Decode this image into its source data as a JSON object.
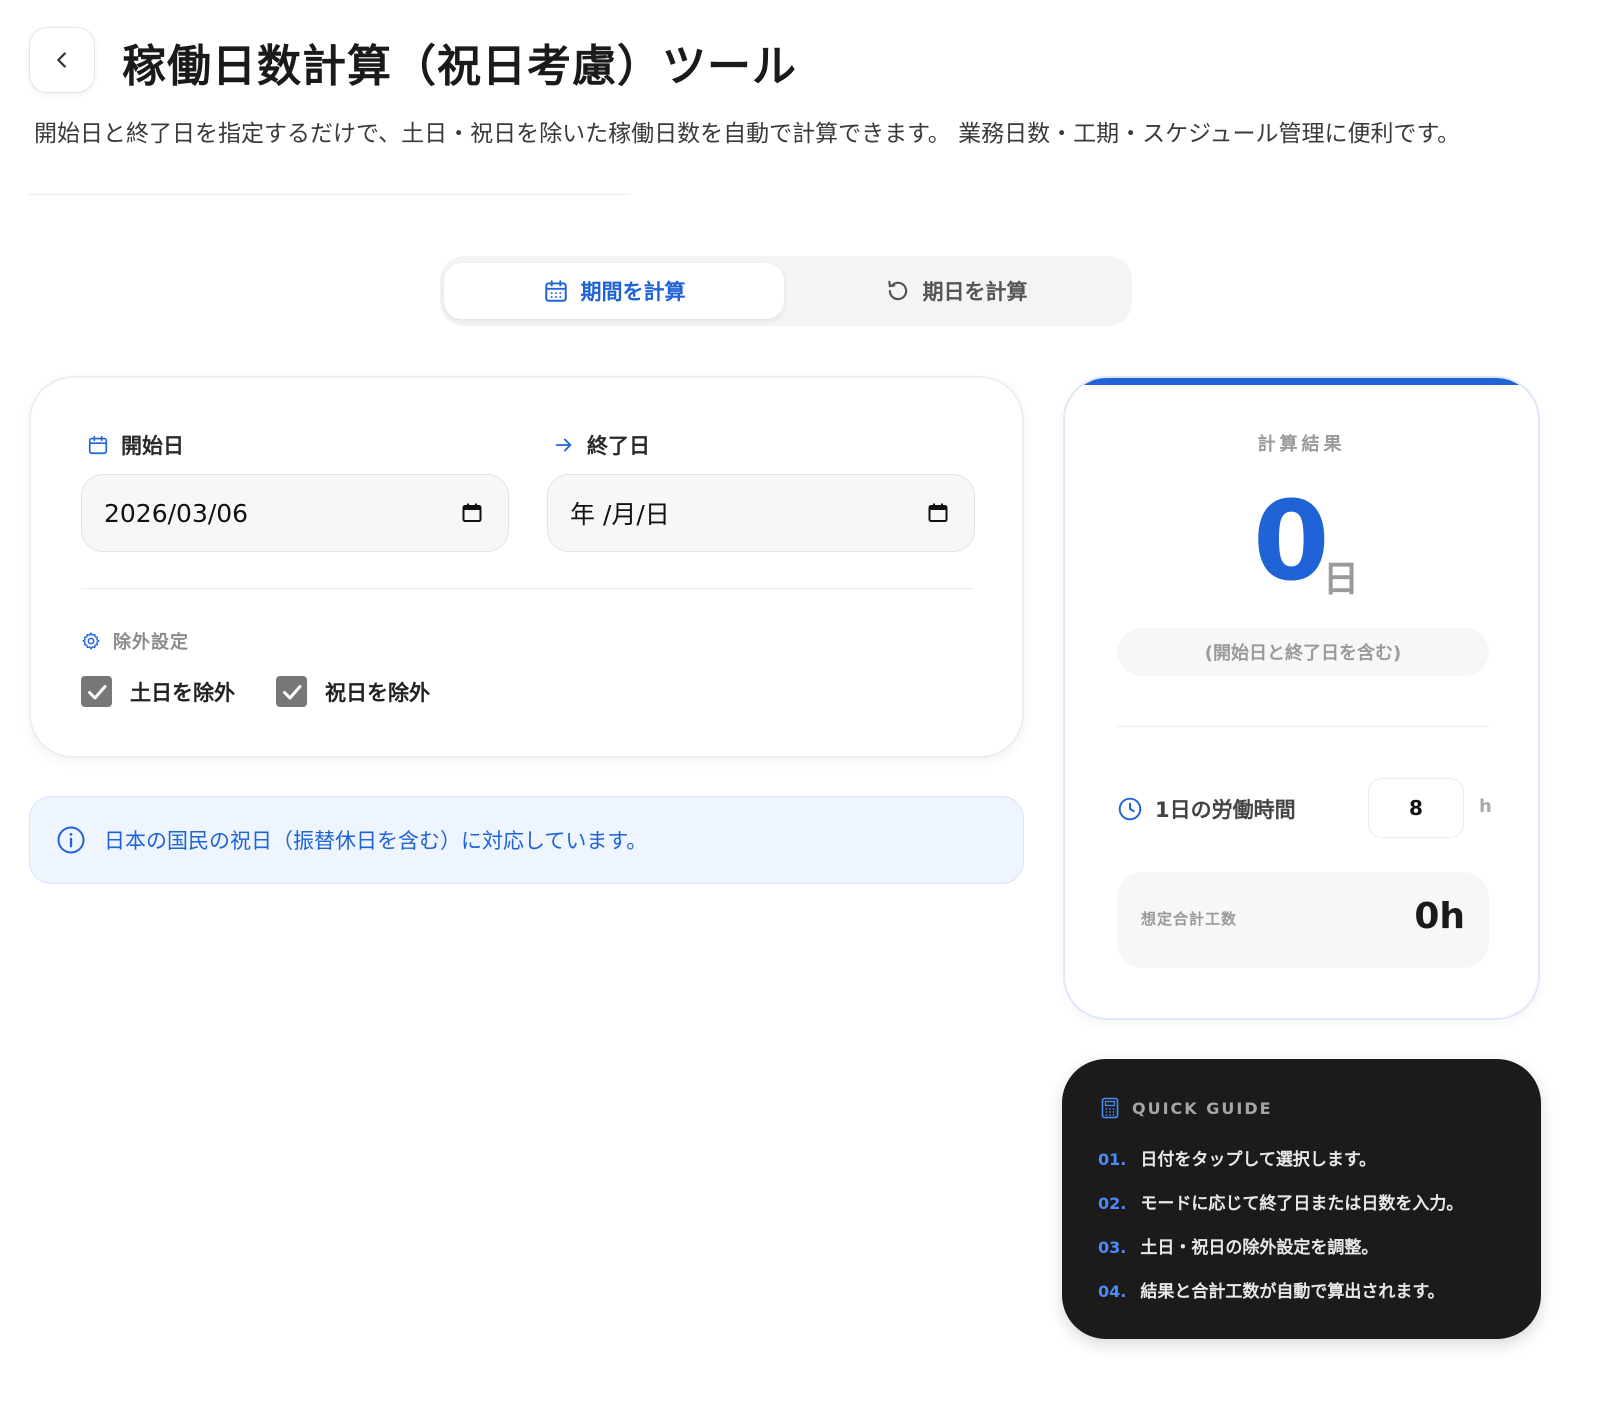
{
  "header": {
    "title": "稼働日数計算（祝日考慮）ツール",
    "description": "開始日と終了日を指定するだけで、土日・祝日を除いた稼働日数を自動で計算できます。 業務日数・工期・スケジュール管理に便利です。"
  },
  "tabs": [
    {
      "label": "期間を計算",
      "active": true
    },
    {
      "label": "期日を計算",
      "active": false
    }
  ],
  "form": {
    "start_label": "開始日",
    "start_value": "2026/03/06",
    "end_label": "終了日",
    "end_value": "年 /月/日",
    "exclusion_label": "除外設定",
    "exclude_weekends": {
      "label": "土日を除外",
      "checked": true
    },
    "exclude_holidays": {
      "label": "祝日を除外",
      "checked": true
    }
  },
  "info": {
    "text": "日本の国民の祝日（振替休日を含む）に対応しています。"
  },
  "result": {
    "heading": "計算結果",
    "days": "0",
    "unit": "日",
    "note": "(開始日と終了日を含む)",
    "hours_label": "1日の労働時間",
    "hours_value": "8",
    "hours_unit": "h",
    "total_label": "想定合計工数",
    "total_value": "0h"
  },
  "guide": {
    "heading": "QUICK GUIDE",
    "items": [
      {
        "num": "01.",
        "text": "日付をタップして選択します。"
      },
      {
        "num": "02.",
        "text": "モードに応じて終了日または日数を入力。"
      },
      {
        "num": "03.",
        "text": "土日・祝日の除外設定を調整。"
      },
      {
        "num": "04.",
        "text": "結果と合計工数が自動で算出されます。"
      }
    ]
  },
  "colors": {
    "accent": "#1f63d6",
    "guide_bg": "#1b1b1b",
    "info_bg": "#eff5fe"
  },
  "icons": [
    "chevron-left-icon",
    "calendar-icon",
    "refresh-icon",
    "arrow-right-icon",
    "gear-icon",
    "check-icon",
    "info-icon",
    "clock-icon",
    "calculator-icon"
  ]
}
